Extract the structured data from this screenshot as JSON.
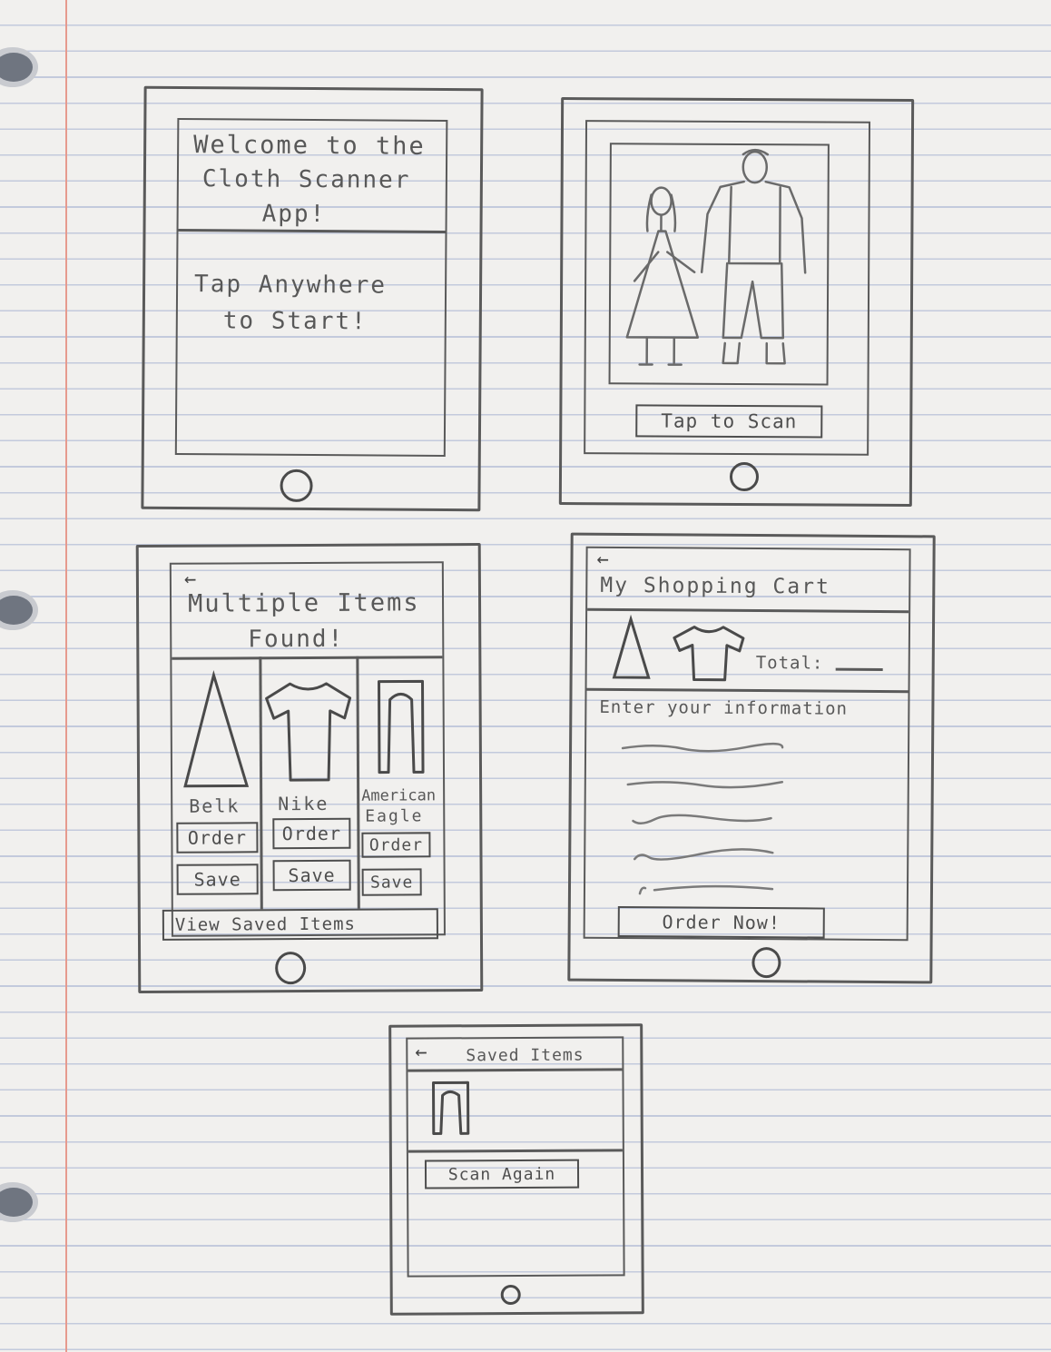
{
  "screens": {
    "welcome": {
      "title_lines": [
        "Welcome to the",
        "Cloth Scanner",
        "App!"
      ],
      "prompt_lines": [
        "Tap Anywhere",
        "to Start!"
      ]
    },
    "scan": {
      "scan_button": "Tap to Scan"
    },
    "multiple_items": {
      "back_icon": "←",
      "title_lines": [
        "Multiple Items",
        "Found!"
      ],
      "items": [
        {
          "brand": "Belk",
          "order": "Order",
          "save": "Save",
          "icon": "dress-icon"
        },
        {
          "brand": "Nike",
          "order": "Order",
          "save": "Save",
          "icon": "shirt-icon"
        },
        {
          "brand_lines": [
            "American",
            "Eagle"
          ],
          "order": "Order",
          "save": "Save",
          "icon": "pants-icon"
        }
      ],
      "view_saved": "View Saved Items"
    },
    "cart": {
      "back_icon": "←",
      "title": "My Shopping Cart",
      "total_label": "Total:",
      "info_label": "Enter your information",
      "order_now": "Order Now!"
    },
    "saved": {
      "back_icon": "←",
      "title": "Saved Items",
      "scan_again": "Scan Again"
    }
  }
}
